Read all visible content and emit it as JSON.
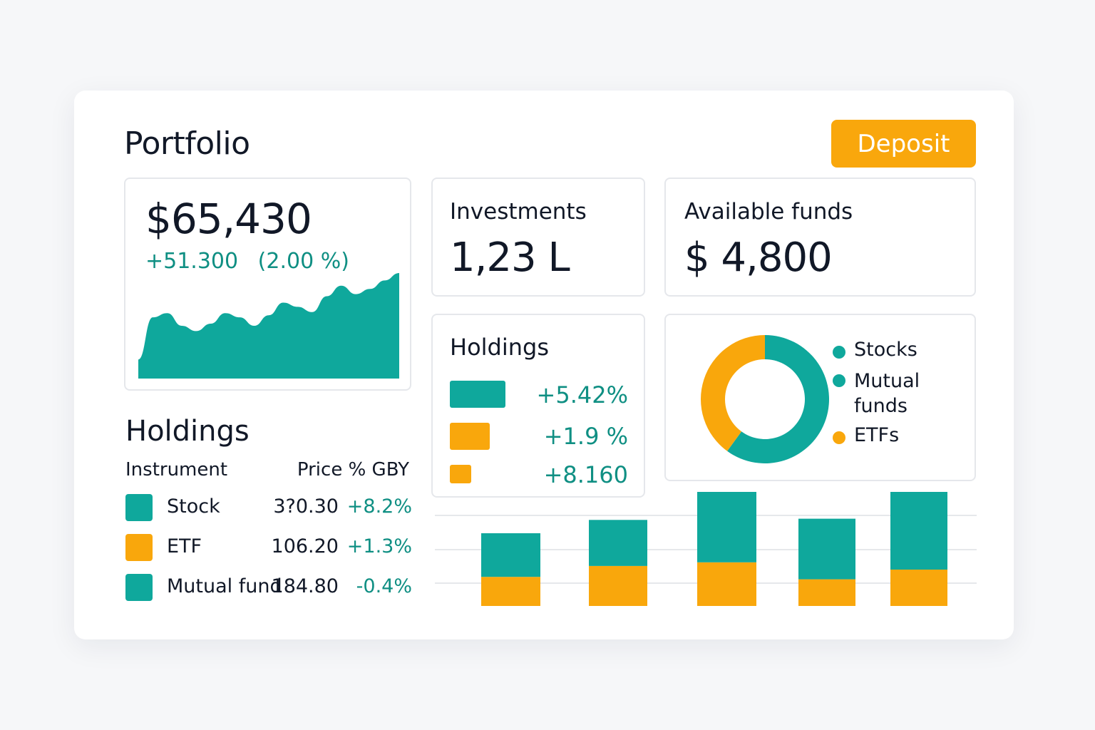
{
  "colors": {
    "teal": "#0fa89c",
    "orange": "#f9a70c",
    "positive": "#0f8f83"
  },
  "header": {
    "title": "Portfolio",
    "deposit_label": "Deposit"
  },
  "total_card": {
    "value": "$65,430",
    "change": "+51.300",
    "change_pct": "(2.00 %)",
    "chart_data": {
      "type": "area",
      "values": [
        0.18,
        0.58,
        0.62,
        0.5,
        0.45,
        0.52,
        0.62,
        0.58,
        0.5,
        0.6,
        0.72,
        0.68,
        0.63,
        0.78,
        0.88,
        0.8,
        0.85,
        0.93,
        1.0
      ],
      "color": "#0fa89c"
    }
  },
  "investments_card": {
    "label": "Investments",
    "value": "1,23 L"
  },
  "funds_card": {
    "label": "Available funds",
    "value": "$ 4,800"
  },
  "holdings_table": {
    "title": "Holdings",
    "headers": [
      "Instrument",
      "Price % GBY"
    ],
    "rows": [
      {
        "name": "Stock",
        "price": "3?0.30",
        "change": "+8.2%",
        "color": "teal"
      },
      {
        "name": "ETF",
        "price": "106.20",
        "change": "+1.3%",
        "color": "orange"
      },
      {
        "name": "Mutual fund",
        "price": "184.80",
        "change": "-0.4%",
        "color": "teal"
      }
    ]
  },
  "holdings_mini": {
    "title": "Holdings",
    "rows": [
      {
        "value": "+5.42%",
        "color": "teal",
        "level": 1.0
      },
      {
        "value": "+1.9 %",
        "color": "orange",
        "level": 0.72
      },
      {
        "value": "+8.160",
        "color": "orange",
        "level": 0.38
      }
    ]
  },
  "allocation": {
    "legend": [
      {
        "label": "Stocks",
        "color": "teal"
      },
      {
        "label": "Mutual funds",
        "color": "teal"
      },
      {
        "label": "ETFs",
        "color": "orange"
      }
    ],
    "chart_data": {
      "type": "pie",
      "slices": [
        {
          "name": "Teal",
          "value": 60,
          "color": "#0fa89c"
        },
        {
          "name": "Orange",
          "value": 40,
          "color": "#f9a70c"
        }
      ]
    }
  },
  "stacked_bars": {
    "chart_data": {
      "type": "bar",
      "stacked": true,
      "series": [
        {
          "values": [
            0.24,
            0.33,
            0.36,
            0.22,
            0.3
          ],
          "color": "#f9a70c"
        },
        {
          "values": [
            0.36,
            0.38,
            0.59,
            0.5,
            0.71
          ],
          "color": "#0fa89c"
        }
      ],
      "grid": true
    }
  }
}
